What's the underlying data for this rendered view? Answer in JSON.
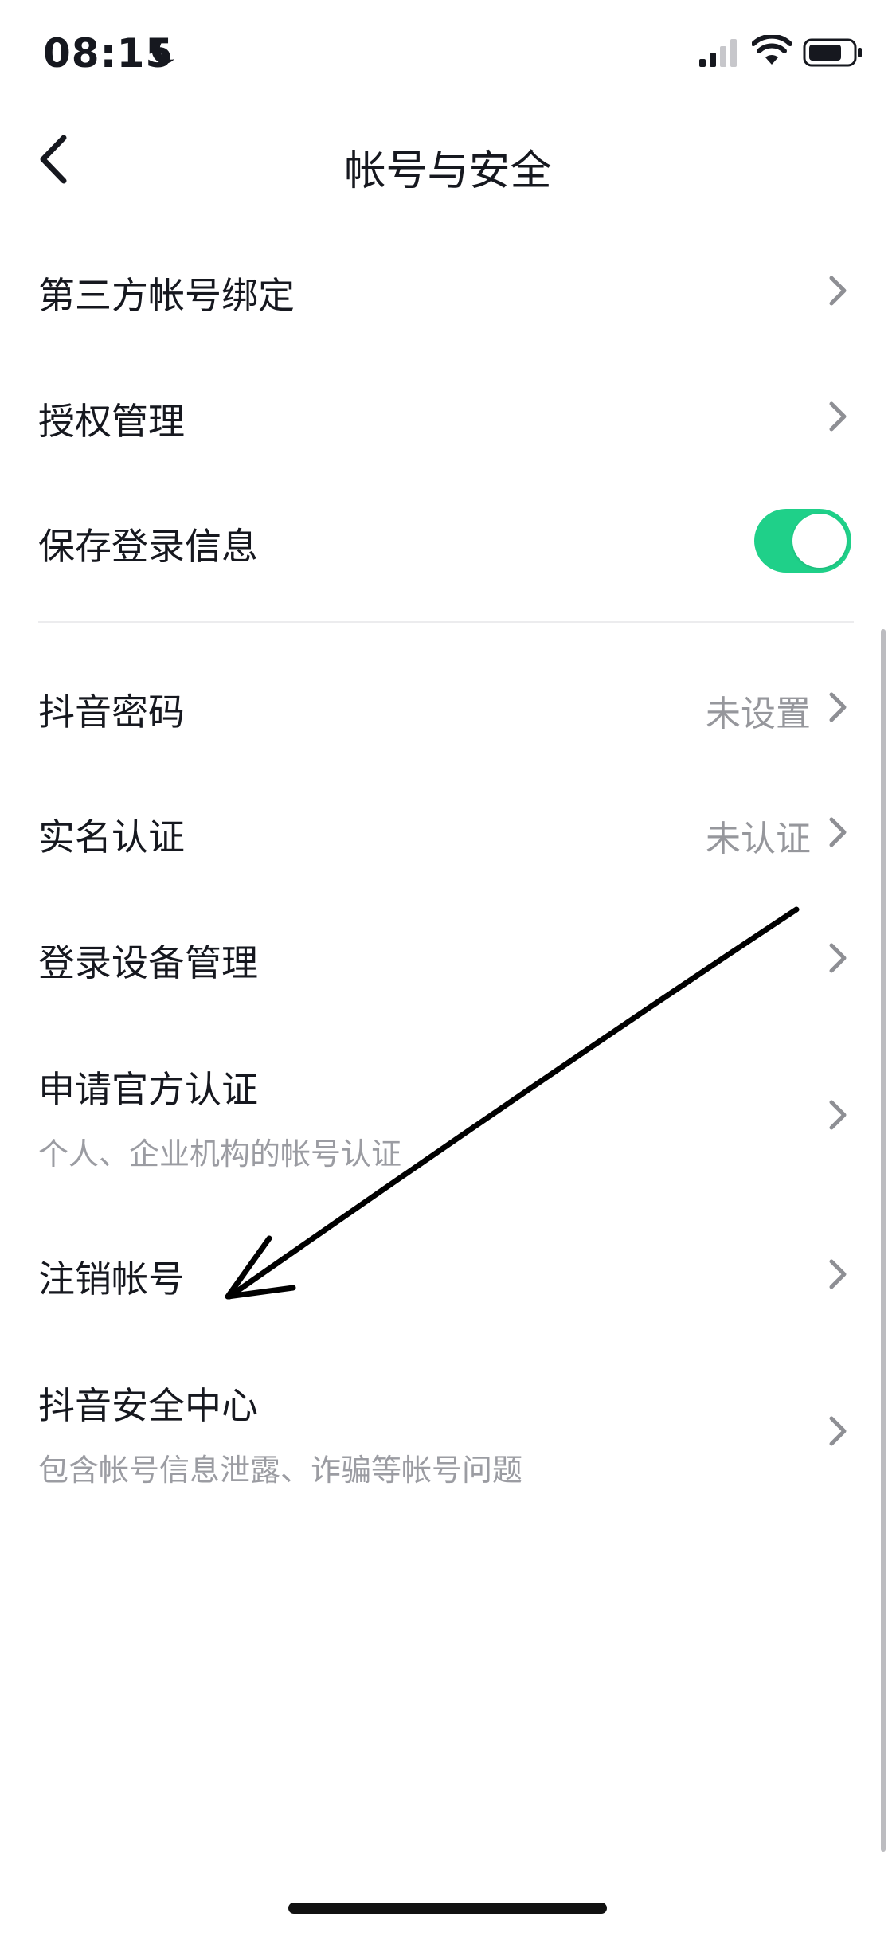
{
  "status_bar": {
    "time": "08:15",
    "icons": [
      "moon-icon",
      "cellular-signal-icon",
      "wifi-icon",
      "battery-icon"
    ]
  },
  "header": {
    "title": "帐号与安全",
    "back_icon": "chevron-left-icon"
  },
  "items": [
    {
      "label": "第三方帐号绑定",
      "type": "link"
    },
    {
      "label": "授权管理",
      "type": "link"
    },
    {
      "label": "保存登录信息",
      "type": "toggle",
      "checked": true
    },
    {
      "label": "抖音密码",
      "value": "未设置",
      "type": "link"
    },
    {
      "label": "实名认证",
      "value": "未认证",
      "type": "link"
    },
    {
      "label": "登录设备管理",
      "type": "link"
    },
    {
      "label": "申请官方认证",
      "subtitle": "个人、企业机构的帐号认证",
      "type": "link"
    },
    {
      "label": "注销帐号",
      "type": "link"
    },
    {
      "label": "抖音安全中心",
      "subtitle": "包含帐号信息泄露、诈骗等帐号问题",
      "type": "link"
    }
  ],
  "colors": {
    "toggle_on": "#1fd089",
    "text_primary": "#16181f",
    "text_secondary": "#9b9ca2",
    "chevron": "#8e8f94",
    "annotation_arrow": "#000000"
  }
}
